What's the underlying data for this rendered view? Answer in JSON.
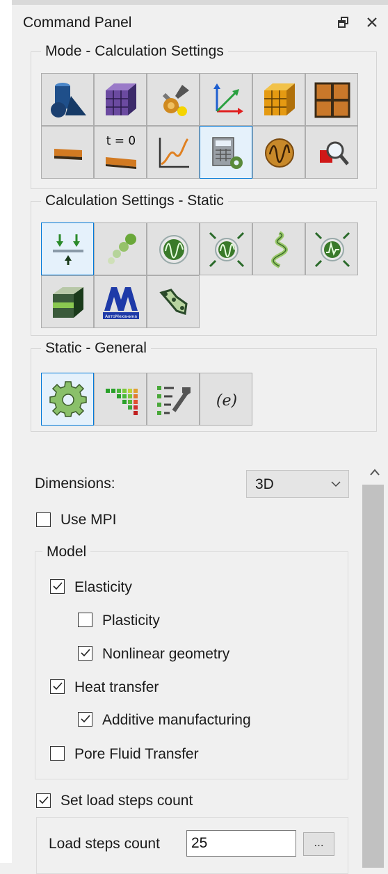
{
  "panel": {
    "title": "Command Panel",
    "float_icon": "float-window-icon",
    "close_icon": "close-icon"
  },
  "groups": {
    "mode": {
      "title": "Mode - Calculation Settings",
      "tools": [
        {
          "name": "geometry-primitives-icon"
        },
        {
          "name": "mesh-cube-icon"
        },
        {
          "name": "tools-wrench-icon"
        },
        {
          "name": "coordinate-axes-icon"
        },
        {
          "name": "grid-cube-icon"
        },
        {
          "name": "frame-grid-icon"
        },
        {
          "name": "beam-section-icon"
        },
        {
          "name": "initial-state-icon",
          "label": "t = 0"
        },
        {
          "name": "chart-curve-icon"
        },
        {
          "name": "calculation-settings-icon",
          "active": true
        },
        {
          "name": "oscillation-icon"
        },
        {
          "name": "results-inspect-icon"
        }
      ]
    },
    "calc": {
      "title": "Calculation Settings - Static",
      "tools": [
        {
          "name": "static-load-icon",
          "active": true
        },
        {
          "name": "buckling-spheres-icon"
        },
        {
          "name": "frequency-icon"
        },
        {
          "name": "frequency-loaded-icon"
        },
        {
          "name": "spiral-spring-icon"
        },
        {
          "name": "response-spectrum-icon"
        },
        {
          "name": "thermal-block-icon"
        },
        {
          "name": "automechanika-logo-icon",
          "label": "АвтоМеханика"
        },
        {
          "name": "chain-link-icon"
        }
      ]
    },
    "general": {
      "title": "Static - General",
      "tools": [
        {
          "name": "gear-settings-icon",
          "active": true
        },
        {
          "name": "heatmap-icon"
        },
        {
          "name": "list-settings-icon"
        },
        {
          "name": "expression-icon",
          "label": "(e)"
        }
      ]
    }
  },
  "form": {
    "dimensions_label": "Dimensions:",
    "dimensions_value": "3D",
    "use_mpi": {
      "label": "Use MPI",
      "checked": false
    },
    "model_title": "Model",
    "options": {
      "elasticity": {
        "label": "Elasticity",
        "checked": true
      },
      "plasticity": {
        "label": "Plasticity",
        "checked": false
      },
      "nonlinear": {
        "label": "Nonlinear geometry",
        "checked": true
      },
      "heat": {
        "label": "Heat transfer",
        "checked": true
      },
      "additive": {
        "label": "Additive manufacturing",
        "checked": true
      },
      "pore": {
        "label": "Pore Fluid Transfer",
        "checked": false
      }
    },
    "set_load_steps": {
      "label": "Set load steps count",
      "checked": true
    },
    "load_steps_label": "Load steps count",
    "load_steps_value": "25",
    "browse_label": "..."
  },
  "colors": {
    "accent": "#0078d7",
    "active_button": "#e5f1fb",
    "button": "#e1e1e1",
    "panel": "#f0f0f0"
  }
}
